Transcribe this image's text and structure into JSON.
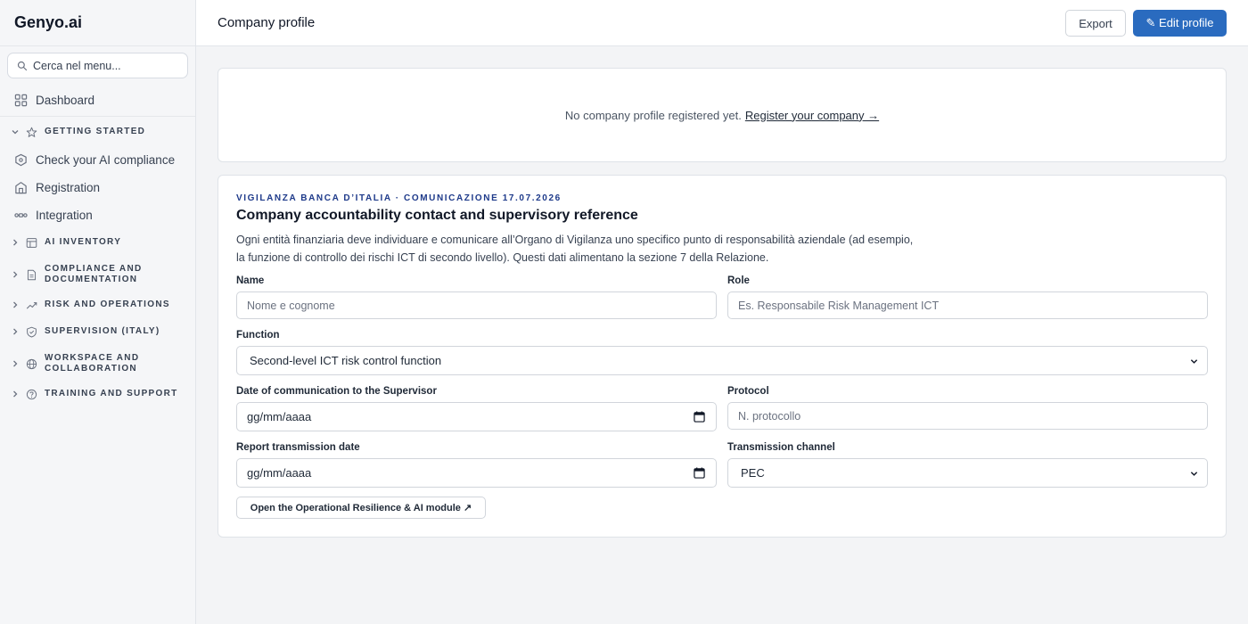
{
  "app": {
    "brand": "Genyo.ai",
    "search_placeholder": "Cerca nel menu...",
    "accent_color": "#2a6bbf"
  },
  "sidebar": {
    "dashboard": {
      "label": "Dashboard",
      "icon": "dashboard-grid-icon"
    },
    "sections": [
      {
        "label": "GETTING STARTED",
        "icon": "star-icon",
        "expanded": true,
        "items": [
          {
            "label": "Check your AI compliance",
            "icon": "shield-check-icon"
          },
          {
            "label": "Registration",
            "icon": "building-icon"
          },
          {
            "label": "Integration",
            "icon": "integration-link-icon"
          }
        ]
      },
      {
        "label": "AI INVENTORY",
        "icon": "table-icon",
        "expanded": false
      },
      {
        "label": "COMPLIANCE AND DOCUMENTATION",
        "icon": "document-icon",
        "expanded": false
      },
      {
        "label": "RISK AND OPERATIONS",
        "icon": "trend-icon",
        "expanded": false
      },
      {
        "label": "SUPERVISION (ITALY)",
        "icon": "shield-icon",
        "expanded": false
      },
      {
        "label": "WORKSPACE AND COLLABORATION",
        "icon": "globe-icon",
        "expanded": false
      },
      {
        "label": "TRAINING AND SUPPORT",
        "icon": "help-icon",
        "expanded": false
      }
    ]
  },
  "header": {
    "title": "Company profile",
    "export_label": "Export",
    "edit_label": "✎ Edit profile"
  },
  "empty_state": {
    "text": "No company profile registered yet.",
    "link_label": "Register your company →"
  },
  "form": {
    "eyebrow": "VIGILANZA BANCA D’ITALIA · COMUNICAZIONE 17.07.2026",
    "title": "Company accountability contact and supervisory reference",
    "description": "Ogni entità finanziaria deve individuare e comunicare all’Organo di Vigilanza uno specifico punto di responsabilità aziendale (ad esempio, la funzione di controllo dei rischi ICT di secondo livello). Questi dati alimentano la sezione 7 della Relazione.",
    "name": {
      "label": "Name",
      "placeholder": "Nome e cognome",
      "value": ""
    },
    "role": {
      "label": "Role",
      "placeholder": "Es. Responsabile Risk Management ICT",
      "value": ""
    },
    "function": {
      "label": "Function",
      "selected": "Second-level ICT risk control function"
    },
    "comm_date": {
      "label": "Date of communication to the Supervisor",
      "value": "gg/mm/aaaa"
    },
    "protocol": {
      "label": "Protocol",
      "placeholder": "N. protocollo",
      "value": ""
    },
    "report_date": {
      "label": "Report transmission date",
      "value": "gg/mm/aaaa"
    },
    "channel": {
      "label": "Transmission channel",
      "selected": "PEC"
    },
    "module_button": "Open the Operational Resilience & AI module ↗"
  }
}
